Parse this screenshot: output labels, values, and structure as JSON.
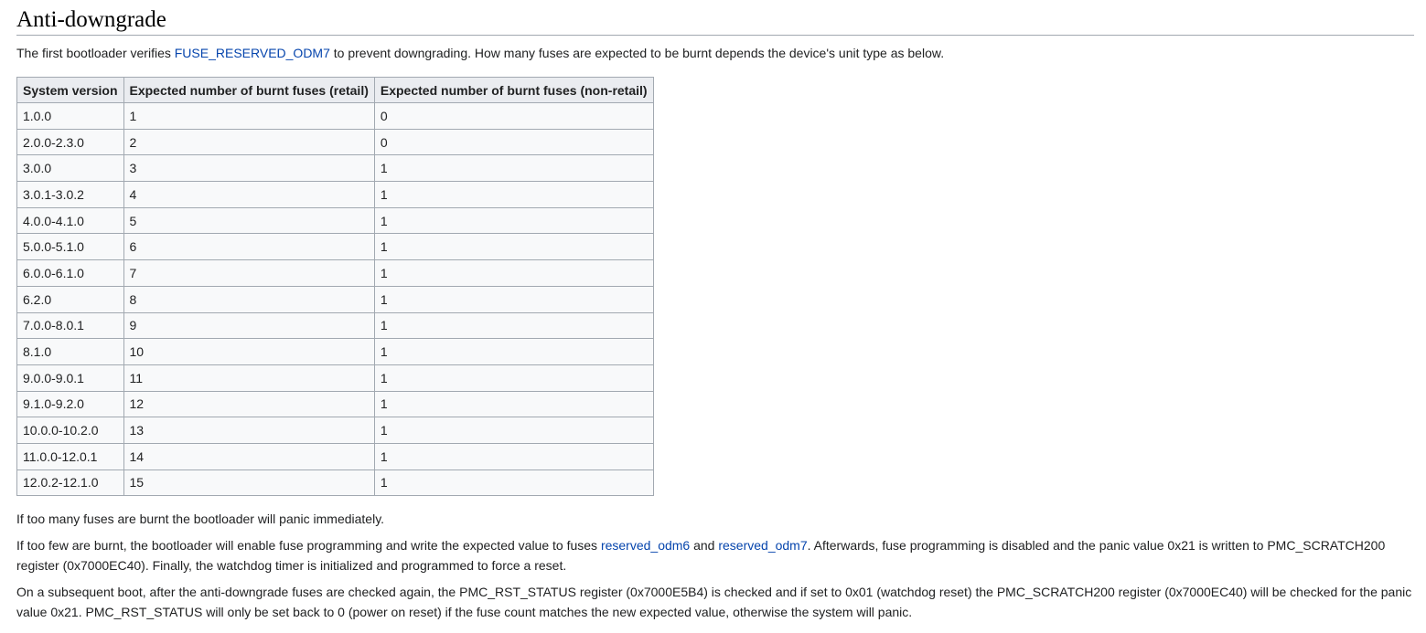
{
  "section": {
    "title": "Anti-downgrade"
  },
  "intro": {
    "before_link": "The first bootloader verifies ",
    "link": "FUSE_RESERVED_ODM7",
    "after_link": " to prevent downgrading. How many fuses are expected to be burnt depends the device's unit type as below."
  },
  "table": {
    "headers": [
      "System version",
      "Expected number of burnt fuses (retail)",
      "Expected number of burnt fuses (non-retail)"
    ],
    "rows": [
      [
        "1.0.0",
        "1",
        "0"
      ],
      [
        "2.0.0-2.3.0",
        "2",
        "0"
      ],
      [
        "3.0.0",
        "3",
        "1"
      ],
      [
        "3.0.1-3.0.2",
        "4",
        "1"
      ],
      [
        "4.0.0-4.1.0",
        "5",
        "1"
      ],
      [
        "5.0.0-5.1.0",
        "6",
        "1"
      ],
      [
        "6.0.0-6.1.0",
        "7",
        "1"
      ],
      [
        "6.2.0",
        "8",
        "1"
      ],
      [
        "7.0.0-8.0.1",
        "9",
        "1"
      ],
      [
        "8.1.0",
        "10",
        "1"
      ],
      [
        "9.0.0-9.0.1",
        "11",
        "1"
      ],
      [
        "9.1.0-9.2.0",
        "12",
        "1"
      ],
      [
        "10.0.0-10.2.0",
        "13",
        "1"
      ],
      [
        "11.0.0-12.0.1",
        "14",
        "1"
      ],
      [
        "12.0.2-12.1.0",
        "15",
        "1"
      ]
    ]
  },
  "para1": {
    "text": "If too many fuses are burnt the bootloader will panic immediately."
  },
  "para2": {
    "part1": "If too few are burnt, the bootloader will enable fuse programming and write the expected value to fuses ",
    "link1": "reserved_odm6",
    "part2": " and ",
    "link2": "reserved_odm7",
    "part3": ". Afterwards, fuse programming is disabled and the panic value 0x21 is written to PMC_SCRATCH200 register (0x7000EC40). Finally, the watchdog timer is initialized and programmed to force a reset."
  },
  "para3": {
    "text": "On a subsequent boot, after the anti-downgrade fuses are checked again, the PMC_RST_STATUS register (0x7000E5B4) is checked and if set to 0x01 (watchdog reset) the PMC_SCRATCH200 register (0x7000EC40) will be checked for the panic value 0x21. PMC_RST_STATUS will only be set back to 0 (power on reset) if the fuse count matches the new expected value, otherwise the system will panic."
  },
  "colors": {
    "link": "#0645ad",
    "text": "#202122",
    "table_border": "#a2a9b1",
    "table_header_bg": "#eaecf0",
    "table_bg": "#f8f9fa"
  }
}
